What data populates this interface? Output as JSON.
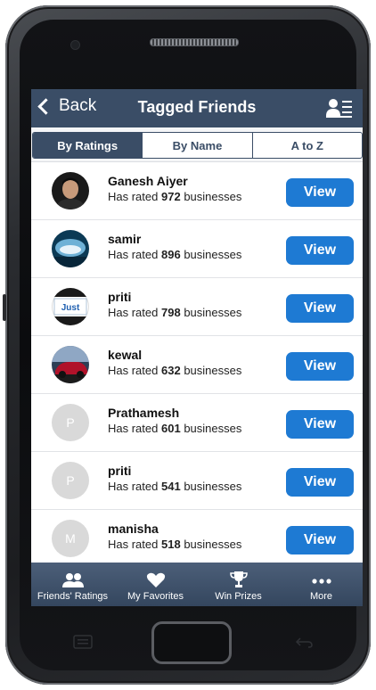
{
  "header": {
    "back_label": "Back",
    "title": "Tagged Friends"
  },
  "segments": [
    {
      "label": "By Ratings",
      "active": true
    },
    {
      "label": "By Name",
      "active": false
    },
    {
      "label": "A to Z",
      "active": false
    }
  ],
  "friends": [
    {
      "name": "Ganesh Aiyer",
      "prefix": "Has rated",
      "count": "972",
      "suffix": "businesses",
      "avatar": "photo",
      "initial": ""
    },
    {
      "name": "samir",
      "prefix": "Has rated",
      "count": "896",
      "suffix": "businesses",
      "avatar": "photo",
      "initial": ""
    },
    {
      "name": "priti",
      "prefix": "Has rated",
      "count": "798",
      "suffix": "businesses",
      "avatar": "logo",
      "initial": ""
    },
    {
      "name": "kewal",
      "prefix": "Has rated",
      "count": "632",
      "suffix": "businesses",
      "avatar": "photo",
      "initial": ""
    },
    {
      "name": "Prathamesh",
      "prefix": "Has rated",
      "count": "601",
      "suffix": "businesses",
      "avatar": "letter",
      "initial": "P"
    },
    {
      "name": "priti",
      "prefix": "Has rated",
      "count": "541",
      "suffix": "businesses",
      "avatar": "letter",
      "initial": "P"
    },
    {
      "name": "manisha",
      "prefix": "Has rated",
      "count": "518",
      "suffix": "businesses",
      "avatar": "letter",
      "initial": "M"
    }
  ],
  "view_label": "View",
  "avatar_logo_text": "Just",
  "tabs": [
    {
      "label": "Friends' Ratings",
      "icon": "friends-icon"
    },
    {
      "label": "My Favorites",
      "icon": "heart-icon"
    },
    {
      "label": "Win Prizes",
      "icon": "trophy-icon"
    },
    {
      "label": "More",
      "icon": "more-dots-icon"
    }
  ],
  "colors": {
    "header": "#3a4d66",
    "button": "#1e7ad3",
    "tabbar": "#3d506a"
  }
}
